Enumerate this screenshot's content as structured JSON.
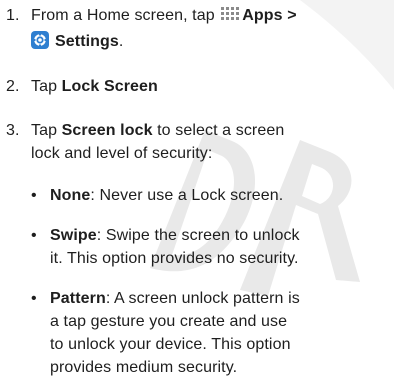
{
  "watermark": {
    "text": "DRAFT"
  },
  "steps": [
    {
      "number": "1.",
      "lines": [
        {
          "pre": "From a Home screen, tap",
          "icon": "apps-grid-icon",
          "bold": "Apps >"
        },
        {
          "icon": "settings-gear-icon",
          "bold": "Settings",
          "post": "."
        }
      ]
    },
    {
      "number": "2.",
      "lines": [
        {
          "pre": "Tap ",
          "bold": "Lock Screen"
        }
      ]
    },
    {
      "number": "3.",
      "lines": [
        {
          "pre": "Tap ",
          "bold": "Screen lock",
          "post": " to select a screen"
        },
        {
          "pre": "lock and level of security:"
        }
      ]
    }
  ],
  "options": [
    {
      "bullet": "•",
      "label": "None",
      "lines": [
        ": Never use a Lock screen."
      ]
    },
    {
      "bullet": "•",
      "label": "Swipe",
      "lines": [
        ": Swipe the screen to unlock",
        "it. This option provides no security."
      ]
    },
    {
      "bullet": "•",
      "label": "Pattern",
      "lines": [
        ": A screen unlock pattern is",
        "a tap gesture you create and use",
        "to unlock your device. This option",
        "provides medium security."
      ]
    }
  ]
}
